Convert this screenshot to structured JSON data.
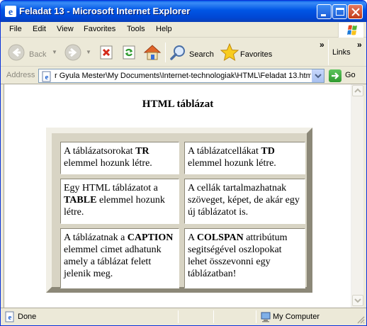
{
  "window": {
    "title": "Feladat 13 - Microsoft Internet Explorer"
  },
  "menu": [
    "File",
    "Edit",
    "View",
    "Favorites",
    "Tools",
    "Help"
  ],
  "toolbar": {
    "back_label": "Back",
    "search_label": "Search",
    "favorites_label": "Favorites",
    "links_label": "Links",
    "overflow": "»"
  },
  "address": {
    "label": "Address",
    "value": "r Gyula Mester\\My Documents\\Internet-technologiak\\HTML\\Feladat 13.htm",
    "go_label": "Go"
  },
  "page": {
    "caption": "HTML táblázat",
    "cells": [
      {
        "pre": "A táblázatsorokat ",
        "bold": "TR",
        "post": " elemmel hozunk létre."
      },
      {
        "pre": "A táblázatcellákat ",
        "bold": "TD",
        "post": " elemmel hozunk létre."
      },
      {
        "pre": "Egy HTML táblázatot a ",
        "bold": "TABLE",
        "post": " elemmel hozunk létre."
      },
      {
        "pre": "A cellák tartalmazhatnak szöveget, képet, de akár egy új táblázatot is.",
        "bold": "",
        "post": ""
      },
      {
        "pre": "A táblázatnak a ",
        "bold": "CAPTION",
        "post": " elemmel cimet adhatunk amely a táblázat felett jelenik meg."
      },
      {
        "pre": "A ",
        "bold": "COLSPAN",
        "post": " attribútum segitségével oszlopokat lehet összevonni egy táblázatban!"
      }
    ]
  },
  "status": {
    "left": "Done",
    "zone": "My Computer"
  },
  "colors": {
    "titlebar": "#0055e5",
    "chrome": "#ece9d8",
    "table_frame": "#d8d4c4"
  }
}
